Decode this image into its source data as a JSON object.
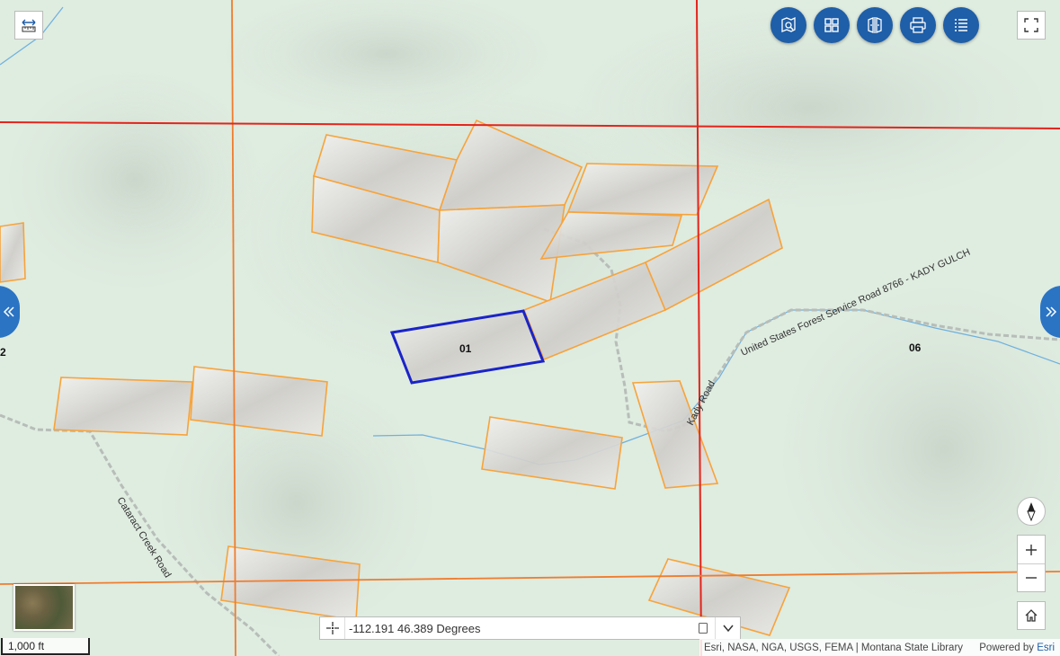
{
  "toolbar": {
    "measure_icon": "measure-ruler-icon",
    "buttons": [
      {
        "name": "search-layers",
        "icon": "map-search-icon"
      },
      {
        "name": "basemap-gallery",
        "icon": "grid-icon"
      },
      {
        "name": "compare",
        "icon": "split-compare-icon"
      },
      {
        "name": "print",
        "icon": "printer-icon"
      },
      {
        "name": "legend",
        "icon": "list-icon"
      }
    ],
    "fullscreen_icon": "fullscreen-icon"
  },
  "map": {
    "parcel_labels": {
      "selected": "01",
      "right": "06",
      "left_edge": "2"
    },
    "road_labels": {
      "forest_road": "United States Forest Service Road 8766 - KADY GULCH",
      "kady_road": "Kady Road",
      "cataract_road": "Cataract Creek Road"
    },
    "colors": {
      "background": "#dfece0",
      "section_line": "#e8602a",
      "township_line": "#e3241b",
      "parcel_outline": "#f7a33a",
      "selected_outline": "#1a24c8",
      "stream": "#6fb1dd",
      "accent": "#1f5ea8"
    }
  },
  "coordinates": {
    "value": "-112.191 46.389 Degrees",
    "locate_icon": "crosshair-icon",
    "copy_icon": "copy-icon",
    "expand_icon": "chevron-down-icon"
  },
  "attribution": {
    "sources": "Esri, NASA, NGA, USGS, FEMA | Montana State Library",
    "powered_prefix": "Powered by ",
    "powered_brand": "Esri"
  },
  "scalebar": {
    "label": "1,000 ft"
  },
  "nav": {
    "zoom_in": "+",
    "zoom_out": "−"
  }
}
